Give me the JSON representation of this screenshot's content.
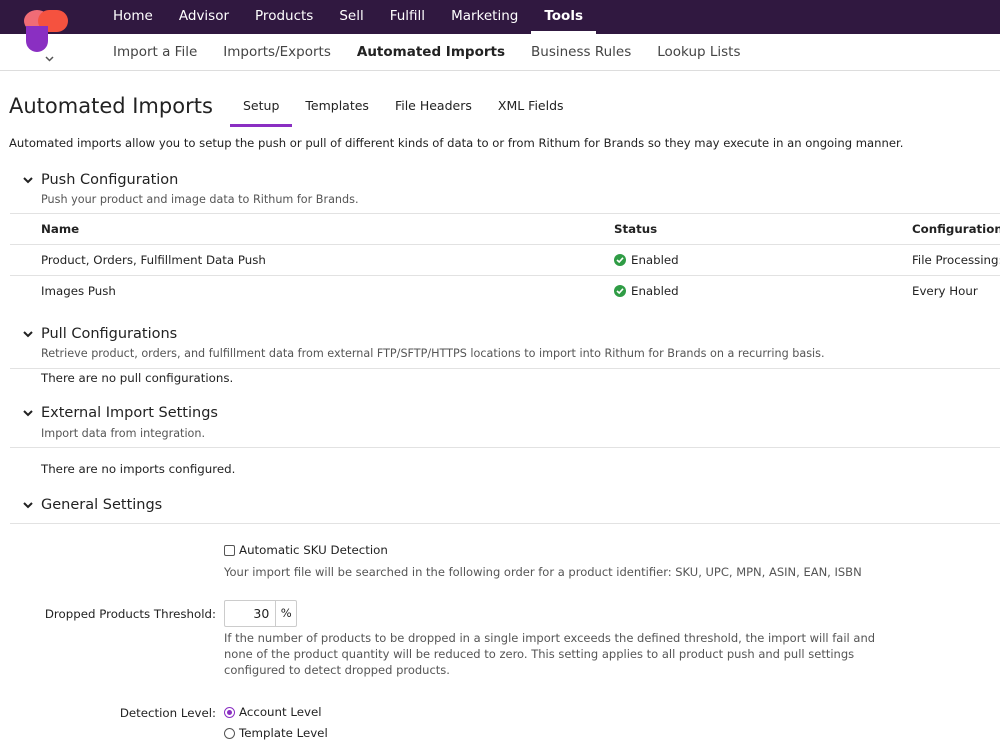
{
  "nav": {
    "primary": [
      {
        "label": "Home"
      },
      {
        "label": "Advisor"
      },
      {
        "label": "Products"
      },
      {
        "label": "Sell"
      },
      {
        "label": "Fulfill"
      },
      {
        "label": "Marketing"
      },
      {
        "label": "Tools"
      }
    ],
    "secondary": [
      {
        "label": "Import a File"
      },
      {
        "label": "Imports/Exports"
      },
      {
        "label": "Automated Imports"
      },
      {
        "label": "Business Rules"
      },
      {
        "label": "Lookup Lists"
      }
    ]
  },
  "page": {
    "title": "Automated Imports",
    "tabs": [
      {
        "label": "Setup"
      },
      {
        "label": "Templates"
      },
      {
        "label": "File Headers"
      },
      {
        "label": "XML Fields"
      }
    ],
    "intro": "Automated imports allow you to setup the push or pull of different kinds of data to or from Rithum for Brands so they may execute in an ongoing manner."
  },
  "push": {
    "title": "Push Configuration",
    "desc": "Push your product and image data to Rithum for Brands.",
    "columns": {
      "name": "Name",
      "status": "Status",
      "config": "Configuration"
    },
    "rows": [
      {
        "name": "Product, Orders, Fulfillment Data Push",
        "status": "Enabled",
        "config": "File Processing:"
      },
      {
        "name": "Images Push",
        "status": "Enabled",
        "config": "Every Hour"
      }
    ]
  },
  "pull": {
    "title": "Pull Configurations",
    "desc": "Retrieve product, orders, and fulfillment data from external FTP/SFTP/HTTPS locations to import into Rithum for Brands on a recurring basis.",
    "empty": "There are no pull configurations."
  },
  "external": {
    "title": "External Import Settings",
    "desc": "Import data from integration.",
    "empty": "There are no imports configured."
  },
  "general": {
    "title": "General Settings",
    "sku_label": "Automatic SKU Detection",
    "sku_help": "Your import file will be searched in the following order for a product identifier: SKU, UPC, MPN, ASIN, EAN, ISBN",
    "threshold_label": "Dropped Products Threshold:",
    "threshold_value": "30",
    "threshold_unit": "%",
    "threshold_help": "If the number of products to be dropped in a single import exceeds the defined threshold, the import will fail and none of the product quantity will be reduced to zero. This setting applies to all product push and pull settings configured to detect dropped products.",
    "detection_label": "Detection Level:",
    "detection_options": [
      {
        "label": "Account Level"
      },
      {
        "label": "Template Level"
      }
    ]
  },
  "colors": {
    "topbar": "#301840",
    "accent": "#8a2fc2",
    "success": "#2f9c45"
  }
}
